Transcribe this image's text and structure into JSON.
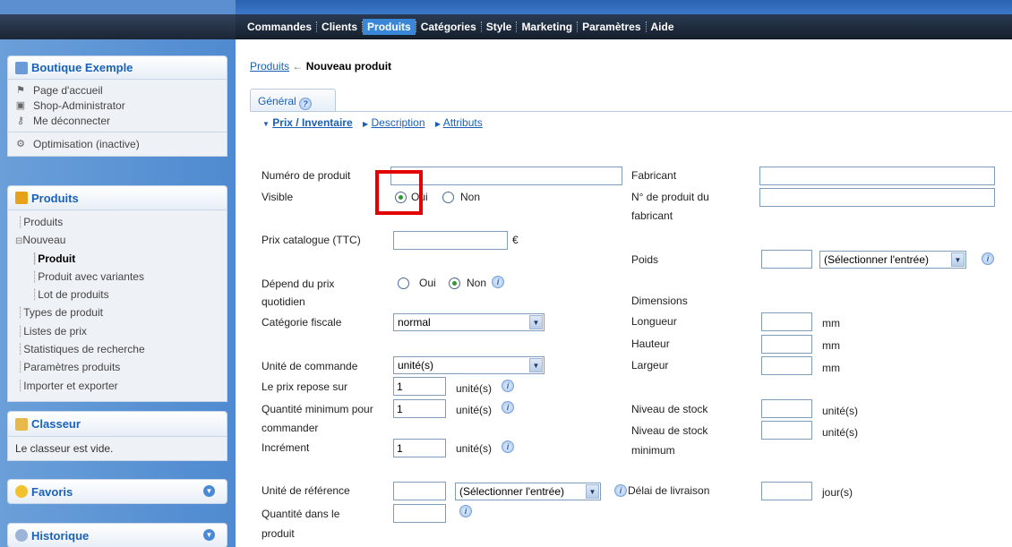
{
  "menu": {
    "items": [
      "Commandes",
      "Clients",
      "Produits",
      "Catégories",
      "Style",
      "Marketing",
      "Paramètres",
      "Aide"
    ]
  },
  "shop": {
    "title": "Boutique Exemple",
    "links": [
      "Page d'accueil",
      "Shop-Administrator",
      "Me déconnecter"
    ],
    "optimisation": "Optimisation (inactive)"
  },
  "products_panel": {
    "title": "Produits",
    "tree": [
      "Produits",
      "Nouveau",
      "Produit",
      "Produit avec variantes",
      "Lot de produits",
      "Types de produit",
      "Listes de prix",
      "Statistiques de recherche",
      "Paramètres produits",
      "Importer et exporter"
    ]
  },
  "clipboard": {
    "title": "Classeur",
    "text": "Le classeur est vide."
  },
  "favorites": {
    "title": "Favoris"
  },
  "history": {
    "title": "Historique"
  },
  "breadcrumb": {
    "link": "Produits",
    "sep": "←",
    "current": "Nouveau produit"
  },
  "tab": {
    "label": "Général"
  },
  "subtabs": [
    "Prix / Inventaire",
    "Description",
    "Attributs"
  ],
  "form": {
    "product_number": "Numéro de produit",
    "visible": "Visible",
    "oui": "Oui",
    "non": "Non",
    "list_price": "Prix catalogue (TTC)",
    "currency": "€",
    "depends_line1": "Dépend du prix",
    "depends_line2": "quotidien",
    "tax_category": "Catégorie fiscale",
    "tax_value": "normal",
    "order_unit": "Unité de commande",
    "order_unit_value": "unité(s)",
    "price_based": "Le prix repose sur",
    "price_based_value": "1",
    "min_qty_line1": "Quantité minimum pour",
    "min_qty_line2": "commander",
    "min_qty_value": "1",
    "increment": "Incrément",
    "increment_value": "1",
    "units": "unité(s)",
    "ref_unit": "Unité de référence",
    "select_entry": "(Sélectionner l'entrée)",
    "qty_product_line1": "Quantité dans le",
    "qty_product_line2": "produit",
    "manufacturer": "Fabricant",
    "mfr_number_line1": "N° de produit du",
    "mfr_number_line2": "fabricant",
    "weight": "Poids",
    "dimensions": "Dimensions",
    "length": "Longueur",
    "height": "Hauteur",
    "width": "Largeur",
    "mm": "mm",
    "stock": "Niveau de stock",
    "min_stock_line1": "Niveau de stock",
    "min_stock_line2": "minimum",
    "delivery": "Délai de livraison",
    "days": "jour(s)"
  }
}
